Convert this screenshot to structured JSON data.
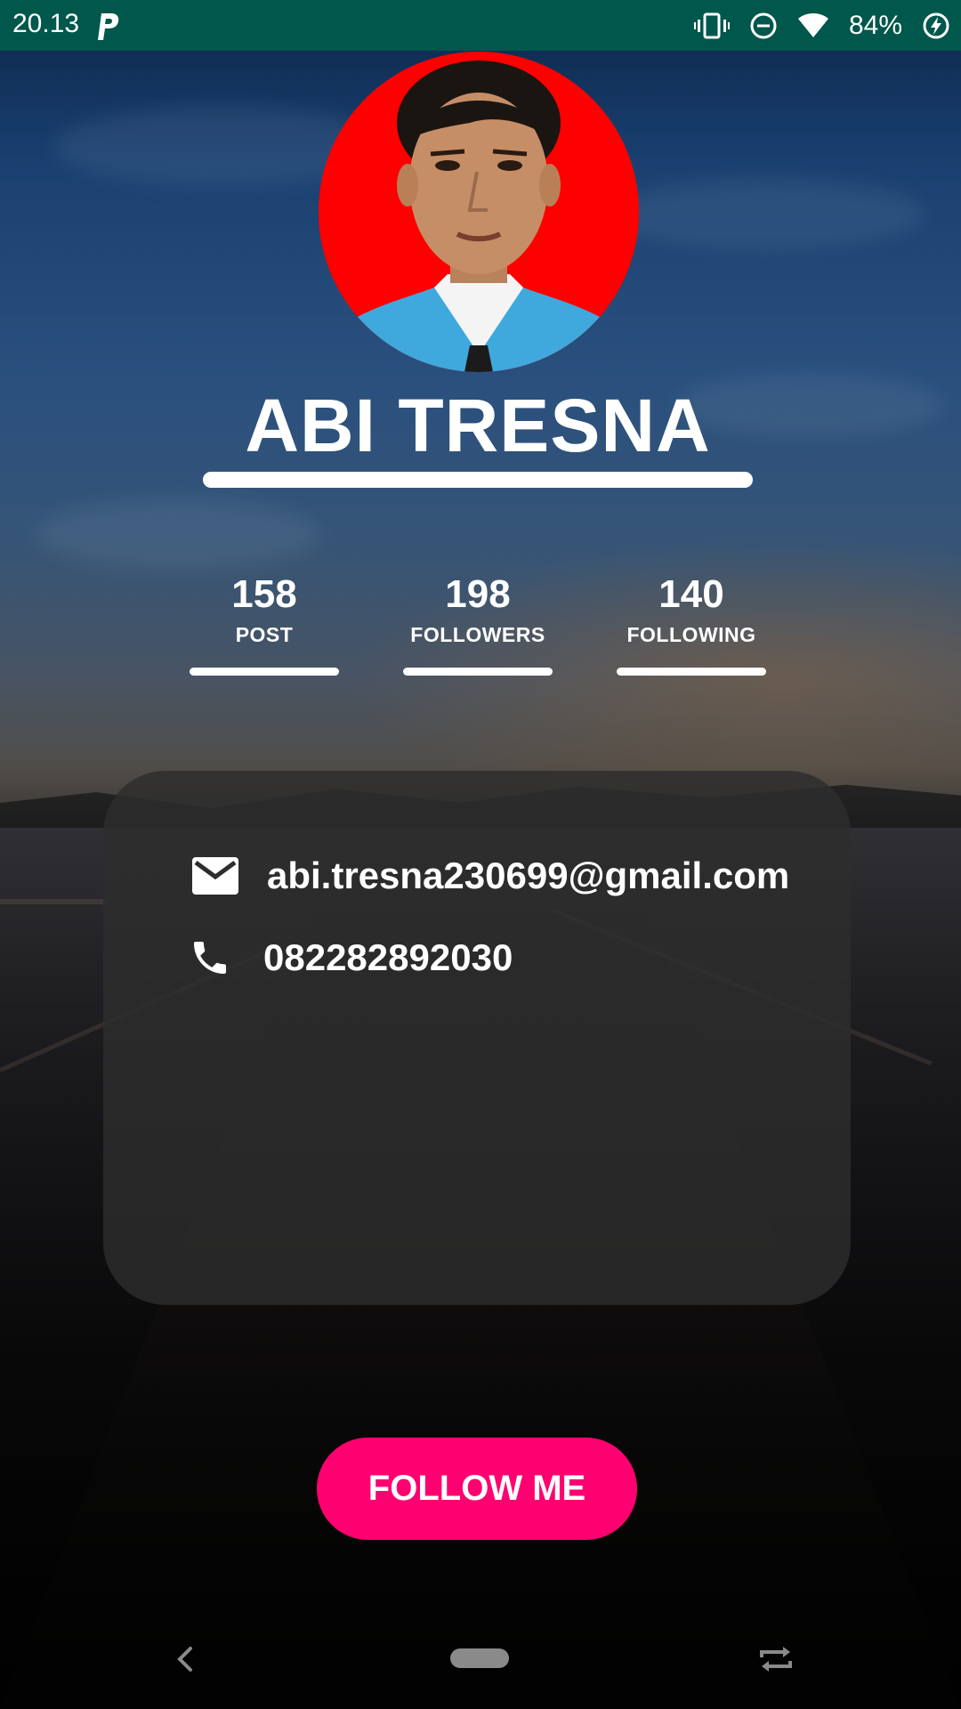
{
  "status_bar": {
    "time": "20.13",
    "app_icon": "parking-p-icon",
    "icons": [
      "vibrate-icon",
      "do-not-disturb-icon",
      "wifi-icon"
    ],
    "battery": "84%",
    "battery_icon": "battery-charging-icon",
    "background_color": "#00574b"
  },
  "profile": {
    "name": "ABI TRESNA",
    "photo_background_color": "#ff0000"
  },
  "stats": [
    {
      "value": "158",
      "label": "POST"
    },
    {
      "value": "198",
      "label": "FOLLOWERS"
    },
    {
      "value": "140",
      "label": "FOLLOWING"
    }
  ],
  "contact": {
    "email_icon": "mail-icon",
    "email": "abi.tresna230699@gmail.com",
    "phone_icon": "phone-icon",
    "phone": "082282892030"
  },
  "actions": {
    "follow_label": "FOLLOW ME",
    "follow_color": "#ff0070"
  },
  "nav_bar": {
    "icons": [
      "back-icon",
      "home-pill-icon",
      "rotate-icon"
    ]
  }
}
